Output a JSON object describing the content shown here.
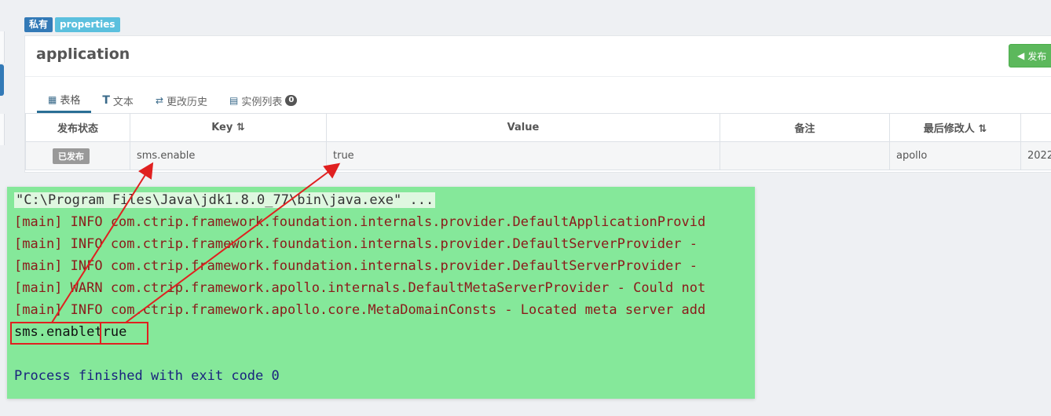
{
  "badges": {
    "private": "私有",
    "format": "properties"
  },
  "namespace": {
    "title": "application",
    "publish_label": "发布"
  },
  "tabs": [
    {
      "label": "表格",
      "icon": "table-icon"
    },
    {
      "label": "文本",
      "icon": "text-icon"
    },
    {
      "label": "更改历史",
      "icon": "history-icon"
    },
    {
      "label": "实例列表",
      "icon": "server-icon",
      "count": "0"
    }
  ],
  "table": {
    "headers": [
      "发布状态",
      "Key",
      "Value",
      "备注",
      "最后修改人",
      ""
    ],
    "row": {
      "status": "已发布",
      "key": "sms.enable",
      "value": "true",
      "comment": "",
      "modifier": "apollo",
      "time": "2022"
    }
  },
  "console": {
    "cmd": "\"C:\\Program Files\\Java\\jdk1.8.0_77\\bin\\java.exe\" ...",
    "logs": [
      "[main] INFO com.ctrip.framework.foundation.internals.provider.DefaultApplicationProvid",
      "[main] INFO com.ctrip.framework.foundation.internals.provider.DefaultServerProvider - ",
      "[main] INFO com.ctrip.framework.foundation.internals.provider.DefaultServerProvider - ",
      "[main] WARN com.ctrip.framework.apollo.internals.DefaultMetaServerProvider - Could not",
      "[main] INFO com.ctrip.framework.apollo.core.MetaDomainConsts - Located meta server add"
    ],
    "output_key": "sms.enable",
    "output_value": "true",
    "finish": "Process finished with exit code 0"
  },
  "colors": {
    "publish": "#5cb85c",
    "console_bg": "#85e89a",
    "annotation": "#e02020"
  }
}
